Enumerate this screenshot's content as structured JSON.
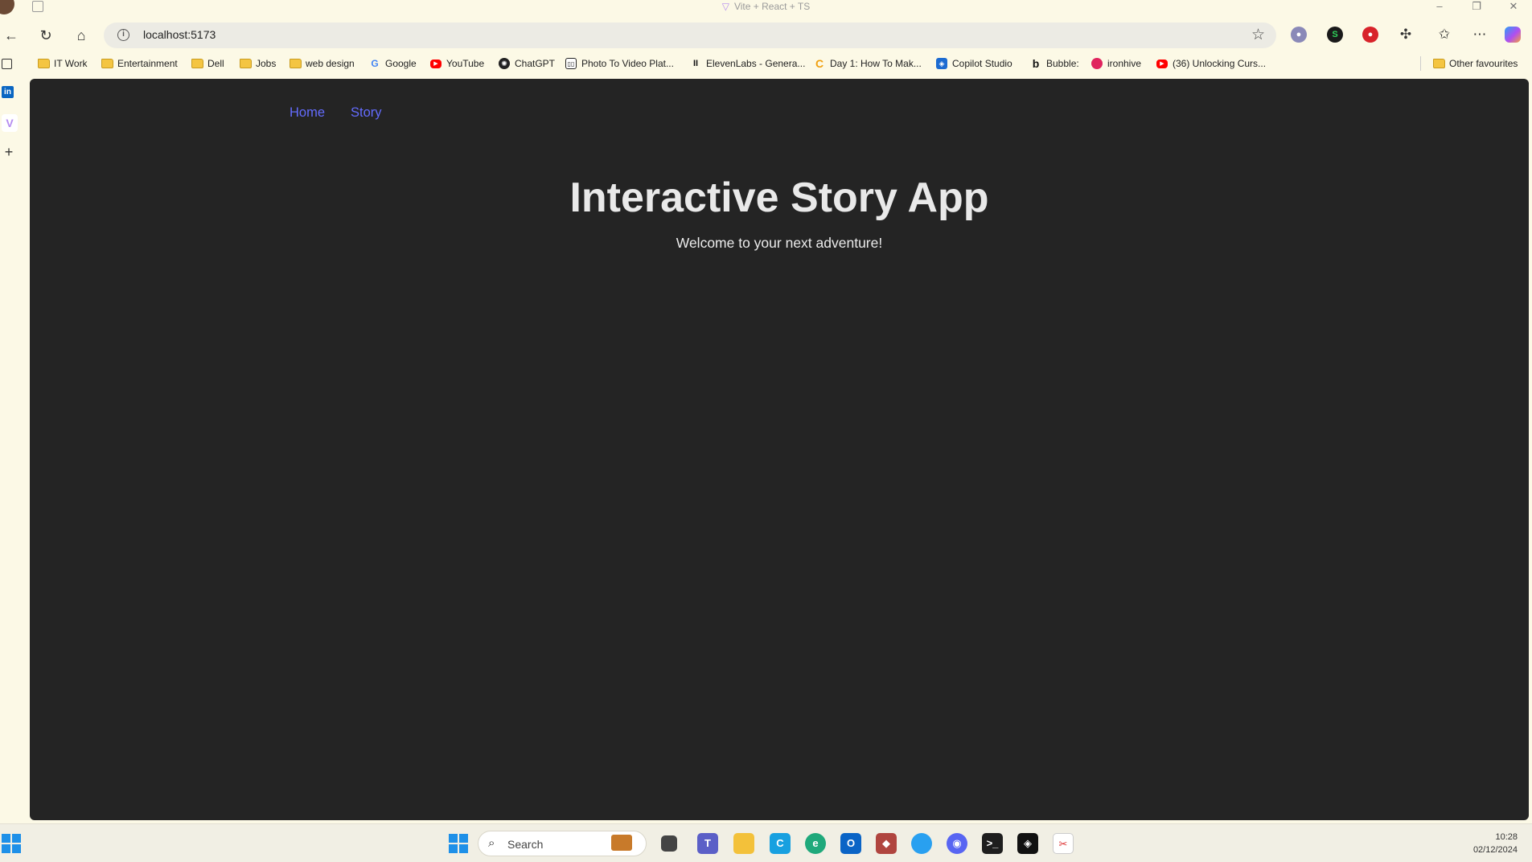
{
  "window": {
    "title": "Vite + React + TS",
    "controls": {
      "minimize": "–",
      "restore": "❐",
      "close": "✕"
    }
  },
  "toolbar": {
    "url": "localhost:5173",
    "icons": [
      "back-icon",
      "refresh-icon",
      "home-icon",
      "info-icon",
      "star-icon",
      "extensions-icon",
      "favorites-icon",
      "more-icon",
      "copilot-icon"
    ]
  },
  "bookmarks": {
    "items": [
      {
        "label": "IT Work",
        "icon": "folder-icon"
      },
      {
        "label": "Entertainment",
        "icon": "folder-icon"
      },
      {
        "label": "Dell",
        "icon": "folder-icon"
      },
      {
        "label": "Jobs",
        "icon": "folder-icon"
      },
      {
        "label": "web design",
        "icon": "folder-icon"
      },
      {
        "label": "Google",
        "icon": "google-icon"
      },
      {
        "label": "YouTube",
        "icon": "youtube-icon"
      },
      {
        "label": "ChatGPT",
        "icon": "chatgpt-icon"
      },
      {
        "label": "Photo To Video Plat...",
        "icon": "photo-video-icon"
      },
      {
        "label": "ElevenLabs - Genera...",
        "icon": "elevenlabs-icon"
      },
      {
        "label": "Day 1: How To Mak...",
        "icon": "c-icon"
      },
      {
        "label": "Copilot Studio",
        "icon": "copilot-studio-icon"
      },
      {
        "label": "Bubble:",
        "icon": "bubble-icon"
      },
      {
        "label": "ironhive",
        "icon": "ironhive-icon"
      },
      {
        "label": "(36) Unlocking Curs...",
        "icon": "youtube-icon"
      }
    ],
    "other": "Other favourites"
  },
  "app": {
    "nav": {
      "home": "Home",
      "story": "Story"
    },
    "title": "Interactive Story App",
    "subtitle": "Welcome to your next adventure!"
  },
  "taskbar": {
    "search_label": "Search",
    "time": "10:28",
    "date": "02/12/2024"
  },
  "colors": {
    "page_bg": "#242424",
    "nav_link": "#646cff",
    "browser_chrome": "#fcf9e6"
  }
}
